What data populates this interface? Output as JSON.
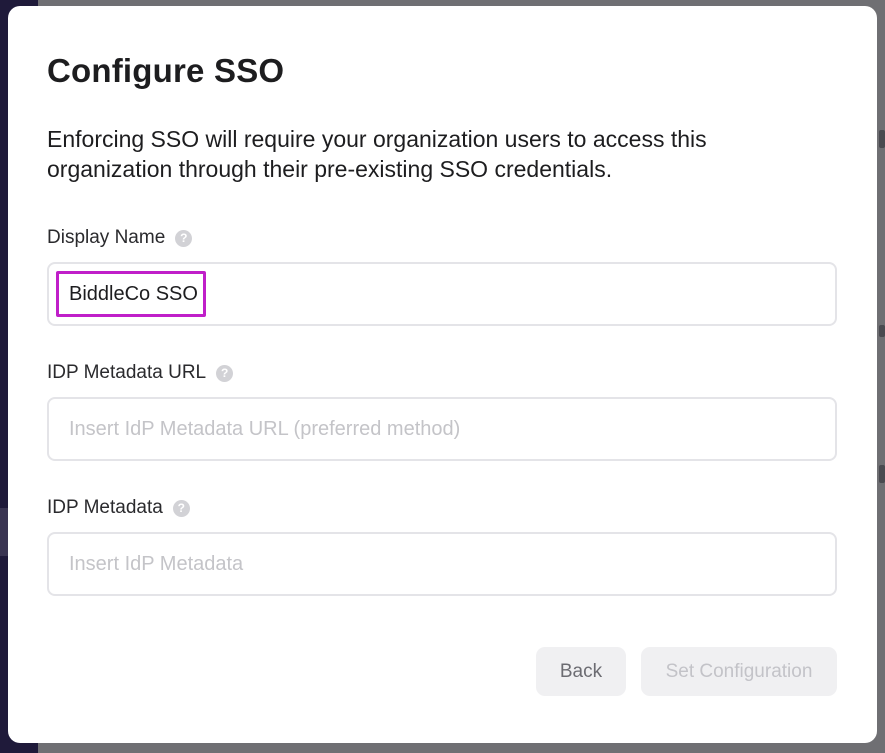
{
  "modal": {
    "title": "Configure SSO",
    "description": "Enforcing SSO will require your organization users to access this organization through their pre-existing SSO credentials."
  },
  "fields": {
    "display_name": {
      "label": "Display Name",
      "value": "BiddleCo SSO",
      "help_icon": "question-circle-icon"
    },
    "idp_metadata_url": {
      "label": "IDP Metadata URL",
      "value": "",
      "placeholder": "Insert IdP Metadata URL (preferred method)",
      "help_icon": "question-circle-icon"
    },
    "idp_metadata": {
      "label": "IDP Metadata",
      "value": "",
      "placeholder": "Insert IdP Metadata",
      "help_icon": "question-circle-icon"
    }
  },
  "buttons": {
    "back_label": "Back",
    "set_configuration_label": "Set Configuration",
    "set_configuration_disabled": true
  },
  "colors": {
    "highlight": "#c01fc9",
    "input_border": "#e4e4e8",
    "button_bg": "#f0f0f2"
  }
}
